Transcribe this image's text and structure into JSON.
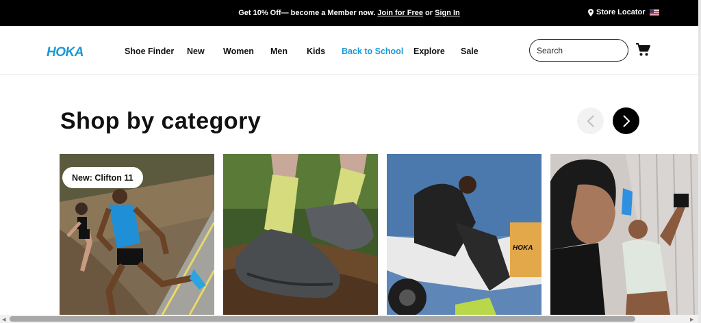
{
  "promo": {
    "text": "Get 10% Off— become a Member now. ",
    "join_link": "Join for Free",
    "or": " or ",
    "signin_link": "Sign In",
    "store_locator": "Store Locator"
  },
  "header": {
    "logo_text": "HOKA",
    "nav": [
      {
        "label": "Shoe Finder"
      },
      {
        "label": "New"
      },
      {
        "label": "Women"
      },
      {
        "label": "Men"
      },
      {
        "label": "Kids"
      },
      {
        "label": "Back to School"
      },
      {
        "label": "Explore"
      },
      {
        "label": "Sale"
      }
    ],
    "search_placeholder": "Search"
  },
  "section": {
    "title": "Shop by category"
  },
  "cards": [
    {
      "badge": "New: Clifton 11",
      "image": "runners-on-road"
    },
    {
      "image": "grey-trail-shoes-in-dirt"
    },
    {
      "image": "rider-on-dirt-bike"
    },
    {
      "image": "athletes-hydrating"
    }
  ],
  "colors": {
    "accent": "#1a9ad6",
    "promo_bg": "#000000",
    "next_arrow_bg": "#000000",
    "prev_arrow_bg": "#f2f2f2"
  }
}
